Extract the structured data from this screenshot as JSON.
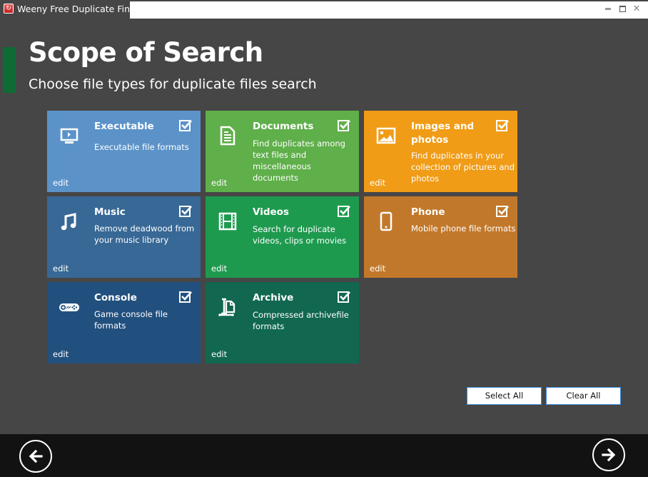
{
  "window": {
    "title": "Weeny Free Duplicate Finder",
    "controls": {
      "minimize": "minimize-icon",
      "maximize": "maximize-icon",
      "close": "close-icon"
    }
  },
  "header": {
    "title": "Scope of Search",
    "subtitle": "Choose file types for duplicate files search"
  },
  "tiles": [
    {
      "title": "Executable",
      "description": "Executable file formats",
      "icon": "monitor-icon",
      "checked": true,
      "edit": "edit",
      "color": "#5b93c9"
    },
    {
      "title": "Documents",
      "description": "Find duplicates among text files and miscellaneous documents",
      "icon": "document-icon",
      "checked": true,
      "edit": "edit",
      "color": "#5faf4a"
    },
    {
      "title": "Images and photos",
      "description": "Find duplicates in your collection of pictures and photos",
      "icon": "image-icon",
      "checked": true,
      "edit": "edit",
      "color": "#f09c17"
    },
    {
      "title": "Music",
      "description": "Remove deadwood from your music library",
      "icon": "music-note-icon",
      "checked": true,
      "edit": "edit",
      "color": "#386895"
    },
    {
      "title": "Videos",
      "description": "Search for duplicate videos, clips or movies",
      "icon": "film-icon",
      "checked": true,
      "edit": "edit",
      "color": "#1e9a4f"
    },
    {
      "title": "Phone",
      "description": "Mobile phone file formats",
      "icon": "phone-icon",
      "checked": true,
      "edit": "edit",
      "color": "#c2782b"
    },
    {
      "title": "Console",
      "description": "Game console file formats",
      "icon": "gamepad-icon",
      "checked": true,
      "edit": "edit",
      "color": "#22507e"
    },
    {
      "title": "Archive",
      "description": "Compressed archivefile formats",
      "icon": "archive-icon",
      "checked": true,
      "edit": "edit",
      "color": "#116750"
    }
  ],
  "buttons": {
    "select_all": "Select All",
    "clear_all": "Clear All"
  },
  "footer": {
    "back": "back-arrow-icon",
    "next": "next-arrow-icon"
  }
}
